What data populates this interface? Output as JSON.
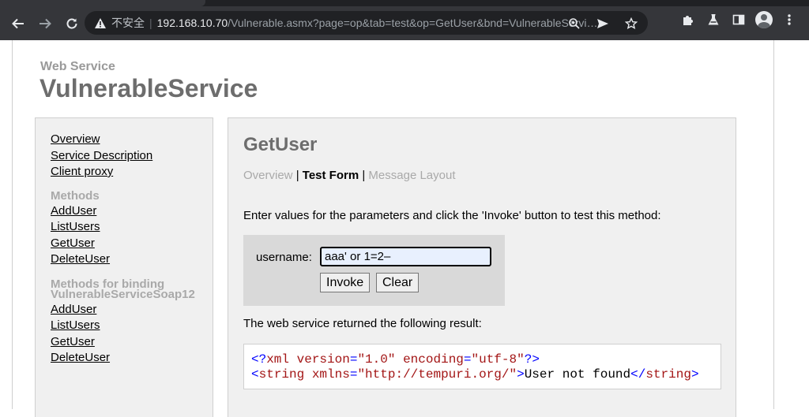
{
  "browser": {
    "security_label": "不安全",
    "separator": "|",
    "url_host": "192.168.10.70",
    "url_path": "/Vulnerable.asmx?page=op&tab=test&op=GetUser&bnd=VulnerableServic…"
  },
  "page": {
    "kicker": "Web Service",
    "service_name": "VulnerableService"
  },
  "leftnav": {
    "top_links": [
      "Overview",
      "Service Description",
      "Client proxy"
    ],
    "methods_heading": "Methods",
    "methods": [
      "AddUser",
      "ListUsers",
      "GetUser",
      "DeleteUser"
    ],
    "binding_heading_line1": "Methods for binding",
    "binding_heading_line2": "VulnerableServiceSoap12",
    "binding_methods": [
      "AddUser",
      "ListUsers",
      "GetUser",
      "DeleteUser"
    ]
  },
  "main": {
    "operation": "GetUser",
    "tabs": {
      "overview": "Overview",
      "test_form": "Test Form",
      "message_layout": "Message Layout",
      "separator": "|"
    },
    "instructions": "Enter values for the parameters and click the 'Invoke' button to test this method:",
    "param_label": "username:",
    "param_value": "aaa' or 1=2–",
    "invoke_label": "Invoke",
    "clear_label": "Clear",
    "result_label": "The web service returned the following result:",
    "result": {
      "line1": {
        "open": "<?",
        "name": "xml",
        "attr1": "version",
        "val1": "\"1.0\"",
        "attr2": "encoding",
        "val2": "\"utf-8\"",
        "close": "?>"
      },
      "line2": {
        "open": "<",
        "tag": "string",
        "attr": "xmlns",
        "val": "\"http://tempuri.org/\"",
        "close": ">",
        "text": "User not found",
        "end_open": "</",
        "end_close": ">"
      }
    }
  },
  "colors": {
    "chrome_bg": "#35363a",
    "panel_bg": "#f0f0f0",
    "heading_gray": "#6d6d6d",
    "muted_gray": "#a9a9a9"
  }
}
